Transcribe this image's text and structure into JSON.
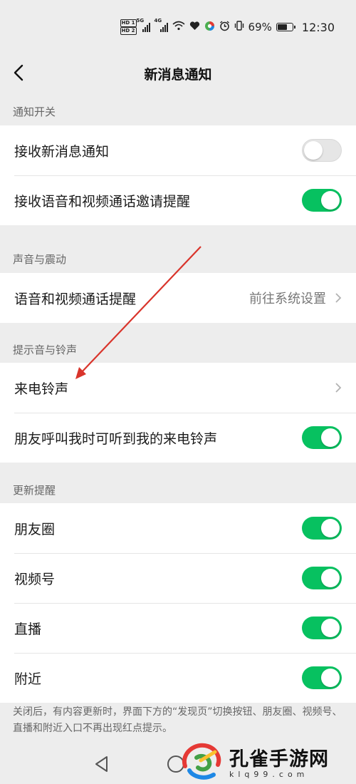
{
  "status_bar": {
    "hd1": "HD 1",
    "hd2": "HD 2",
    "sig1": "5G",
    "sig2": "4G",
    "battery_percent": "69%",
    "battery_level": 0.69,
    "time": "12:30"
  },
  "nav": {
    "title": "新消息通知"
  },
  "sections": {
    "notify": {
      "header": "通知开关",
      "receive_label": "接收新消息通知",
      "receive_on": false,
      "call_invite_label": "接收语音和视频通话邀请提醒",
      "call_invite_on": true
    },
    "sound": {
      "header": "声音与震动",
      "call_alert_label": "语音和视频通话提醒",
      "call_alert_value": "前往系统设置"
    },
    "ringtone": {
      "header": "提示音与铃声",
      "ringtone_label": "来电铃声",
      "friend_hear_label": "朋友呼叫我时可听到我的来电铃声",
      "friend_hear_on": true
    },
    "updates": {
      "header": "更新提醒",
      "moments_label": "朋友圈",
      "moments_on": true,
      "channels_label": "视频号",
      "channels_on": true,
      "live_label": "直播",
      "live_on": true,
      "nearby_label": "附近",
      "nearby_on": true
    }
  },
  "footnote": "关闭后，有内容更新时，界面下方的“发现页”切换按钮、朋友圈、视频号、直播和附近入口不再出现红点提示。",
  "watermark": {
    "title": "孔雀手游网",
    "sub": "klq99.com"
  },
  "colors": {
    "toggle_on": "#07c160",
    "annotation_arrow": "#d9342b"
  }
}
